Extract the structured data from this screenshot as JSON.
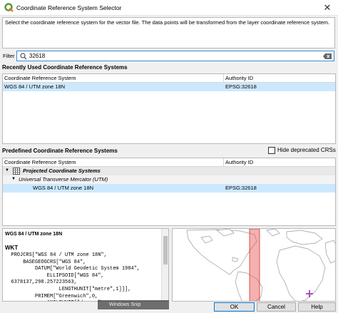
{
  "window": {
    "title": "Coordinate Reference System Selector"
  },
  "description": "Select the coordinate reference system for the vector file. The data points will be transformed from the layer coordinate reference system.",
  "filter": {
    "label": "Filter",
    "value": "32618"
  },
  "recent": {
    "title": "Recently Used Coordinate Reference Systems",
    "columns": [
      "Coordinate Reference System",
      "Authority ID"
    ],
    "rows": [
      {
        "name": "WGS 84 / UTM zone 18N",
        "id": "EPSG:32618"
      }
    ]
  },
  "predefined": {
    "title": "Predefined Coordinate Reference Systems",
    "hide_deprecated_label": "Hide deprecated CRSs",
    "columns": [
      "Coordinate Reference System",
      "Authority ID"
    ],
    "group": "Projected Coordinate Systems",
    "subgroup": "Universal Transverse Mercator (UTM)",
    "item": {
      "name": "WGS 84 / UTM zone 18N",
      "id": "EPSG:32618"
    }
  },
  "details": {
    "crs_name": "WGS 84 / UTM zone 18N",
    "wkt_heading": "WKT",
    "wkt_text": "  PROJCRS[\"WGS 84 / UTM zone 18N\",\n      BASEGEOGCRS[\"WGS 84\",\n          DATUM[\"World Geodetic System 1984\",\n              ELLIPSOID[\"WGS 84\",\n  6378137,298.257223563,\n                  LENGTHUNIT[\"metre\",1]]],\n          PRIMEM[\"Greenwich\",0,\n              ANGLEUNIT[\"degree\","
  },
  "buttons": {
    "ok": "OK",
    "cancel": "Cancel",
    "help": "Help"
  },
  "overlay": {
    "snip_label": "Windows Snip"
  },
  "colors": {
    "selection": "#cce8ff",
    "accent": "#0078d7",
    "extent": "#e85050"
  }
}
